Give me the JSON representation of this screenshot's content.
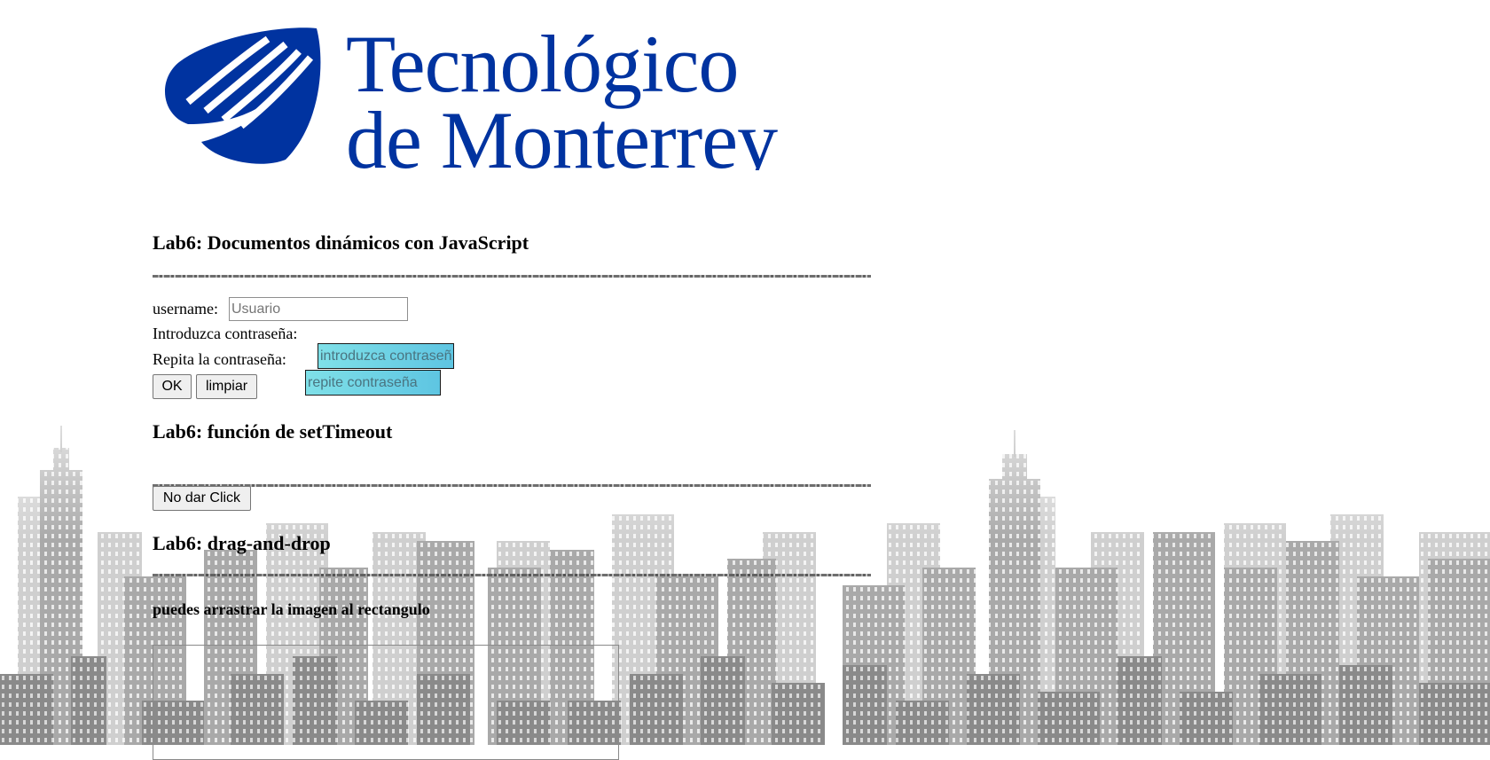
{
  "logo": {
    "line1": "Tecnológico",
    "line2": "de Monterrey",
    "color": "#0033a0"
  },
  "section1": {
    "title": "Lab6: Documentos dinámicos con JavaScript",
    "username_label": "username:",
    "username_placeholder": "Usuario",
    "username_value": "",
    "password_label": "Introduzca contraseña:",
    "password_placeholder": "introduzca contraseña",
    "repeat_label": "Repita la contraseña:",
    "repeat_placeholder": "repite contraseña",
    "ok_button": "OK",
    "clear_button": "limpiar"
  },
  "section2": {
    "title": "Lab6: función de setTimeout",
    "button": "No dar Click"
  },
  "section3": {
    "title": "Lab6: drag-and-drop",
    "instructions": "puedes arrastrar la imagen al rectangulo"
  },
  "colors": {
    "input_gradient_start": "#7fe0e8",
    "input_gradient_end": "#5ec5e2",
    "skyline_gray": "#9e9e9e"
  }
}
